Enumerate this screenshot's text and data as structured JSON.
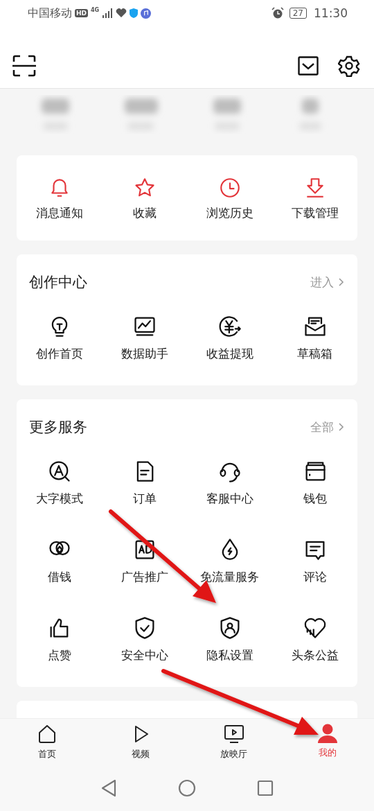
{
  "status_bar": {
    "carrier": "中国移动",
    "hd_badge": "HD",
    "network": "4G",
    "battery": "27",
    "time": "11:30"
  },
  "quick_actions": [
    {
      "label": "消息通知"
    },
    {
      "label": "收藏"
    },
    {
      "label": "浏览历史"
    },
    {
      "label": "下载管理"
    }
  ],
  "sections": [
    {
      "title": "创作中心",
      "link": "进入",
      "items": [
        {
          "label": "创作首页"
        },
        {
          "label": "数据助手"
        },
        {
          "label": "收益提现"
        },
        {
          "label": "草稿箱"
        }
      ]
    },
    {
      "title": "更多服务",
      "link": "全部",
      "items": [
        {
          "label": "大字模式"
        },
        {
          "label": "订单"
        },
        {
          "label": "客服中心"
        },
        {
          "label": "钱包"
        },
        {
          "label": "借钱"
        },
        {
          "label": "广告推广"
        },
        {
          "label": "免流量服务"
        },
        {
          "label": "评论"
        },
        {
          "label": "点赞"
        },
        {
          "label": "安全中心"
        },
        {
          "label": "隐私设置"
        },
        {
          "label": "头条公益"
        }
      ]
    }
  ],
  "bottom_nav": [
    {
      "label": "首页",
      "selected": false
    },
    {
      "label": "视频",
      "selected": false
    },
    {
      "label": "放映厅",
      "selected": false
    },
    {
      "label": "我的",
      "selected": true
    }
  ]
}
